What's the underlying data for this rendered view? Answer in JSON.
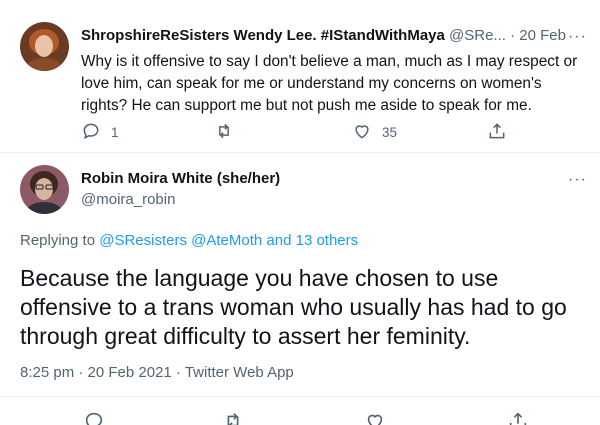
{
  "tweet1": {
    "name": "ShropshireReSisters Wendy Lee. #IStandWithMaya",
    "handle": "@SRe...",
    "separator": "·",
    "date": "20 Feb",
    "text": "Why is it offensive to say I don't believe a man, much as I may respect or love him, can speak for me or understand my concerns on women's rights? He can support me but not push me aside to speak for me.",
    "more_label": "···",
    "replies": "1",
    "retweets": "",
    "likes": "35"
  },
  "tweet2": {
    "name": "Robin Moira White (she/her)",
    "handle": "@moira_robin",
    "more_label": "···",
    "replying_prefix": "Replying to",
    "reply_user1": "@SResisters",
    "reply_user2": "@AteMoth",
    "reply_others": "and 13 others",
    "text": "Because the language you have chosen to use offensive to a trans woman who usually has had to go through great difficulty to assert her feminity.",
    "meta": "8:25 pm · 20 Feb 2021 · Twitter Web App"
  },
  "colors": {
    "link": "#1d9bf0",
    "secondary_text": "#536471",
    "divider": "#eff3f4"
  },
  "icons": [
    "reply-icon",
    "retweet-icon",
    "like-icon",
    "share-icon",
    "more-icon"
  ]
}
